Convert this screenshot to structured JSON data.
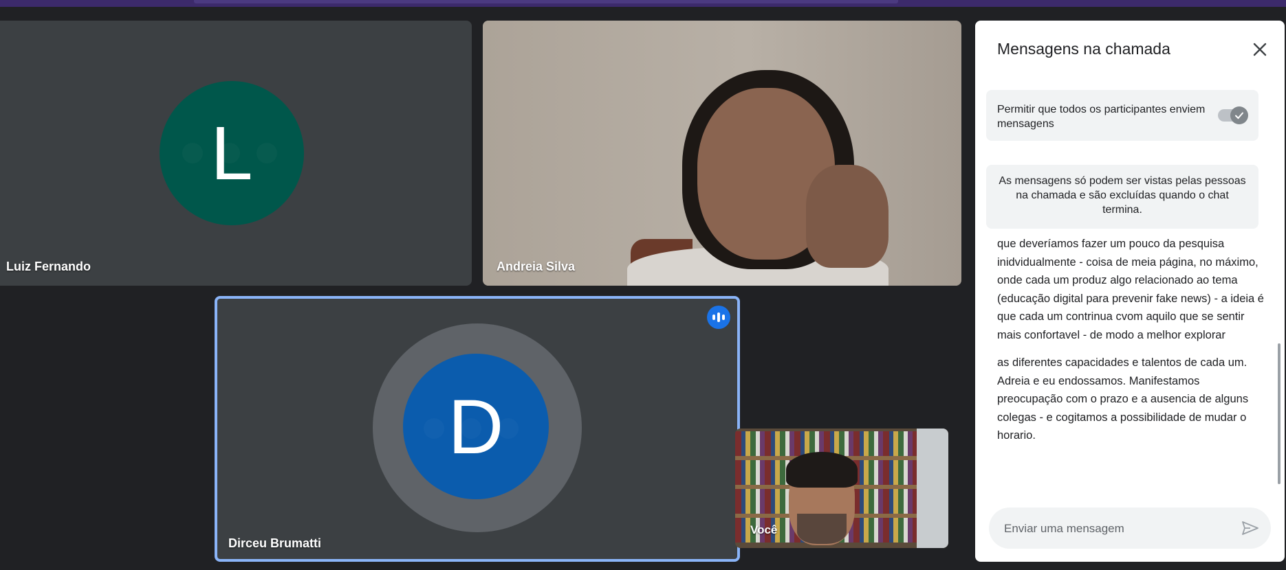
{
  "participants": {
    "luiz": {
      "name": "Luiz Fernando",
      "initial": "L",
      "avatar_color": "#00574b"
    },
    "andreia": {
      "name": "Andreia Silva"
    },
    "dirceu": {
      "name": "Dirceu Brumatti",
      "initial": "D",
      "avatar_color": "#0b5cad",
      "speaking": true
    },
    "self": {
      "name": "Você"
    }
  },
  "chat": {
    "title": "Mensagens na chamada",
    "setting_label": "Permitir que todos os participantes enviem mensagens",
    "setting_enabled": true,
    "notice": "As mensagens só podem ser vistas pelas pessoas na chamada e são excluídas quando o chat termina.",
    "messages": [
      "que deveríamos fazer um pouco da pesquisa inidvidualmente - coisa de meia página, no máximo, onde cada um produz algo relacionado ao tema (educação digital para prevenir fake news) - a ideia é que cada um contrinua cvom aquilo que se sentir mais confortavel - de modo a melhor explorar",
      "as diferentes capacidades e talentos de cada um. Adreia e eu endossamos. Manifestamos preocupação com o prazo e a ausencia de alguns colegas - e cogitamos a possibilidade de mudar o horario."
    ],
    "compose_placeholder": "Enviar uma mensagem"
  },
  "colors": {
    "accent": "#1a73e8",
    "active_border": "#8ab4f8",
    "background": "#202124",
    "tile": "#3c4043"
  },
  "icons": [
    "close-icon",
    "check-icon",
    "send-icon",
    "speaking-indicator-icon",
    "pin-icon",
    "mic-icon",
    "remove-icon"
  ]
}
